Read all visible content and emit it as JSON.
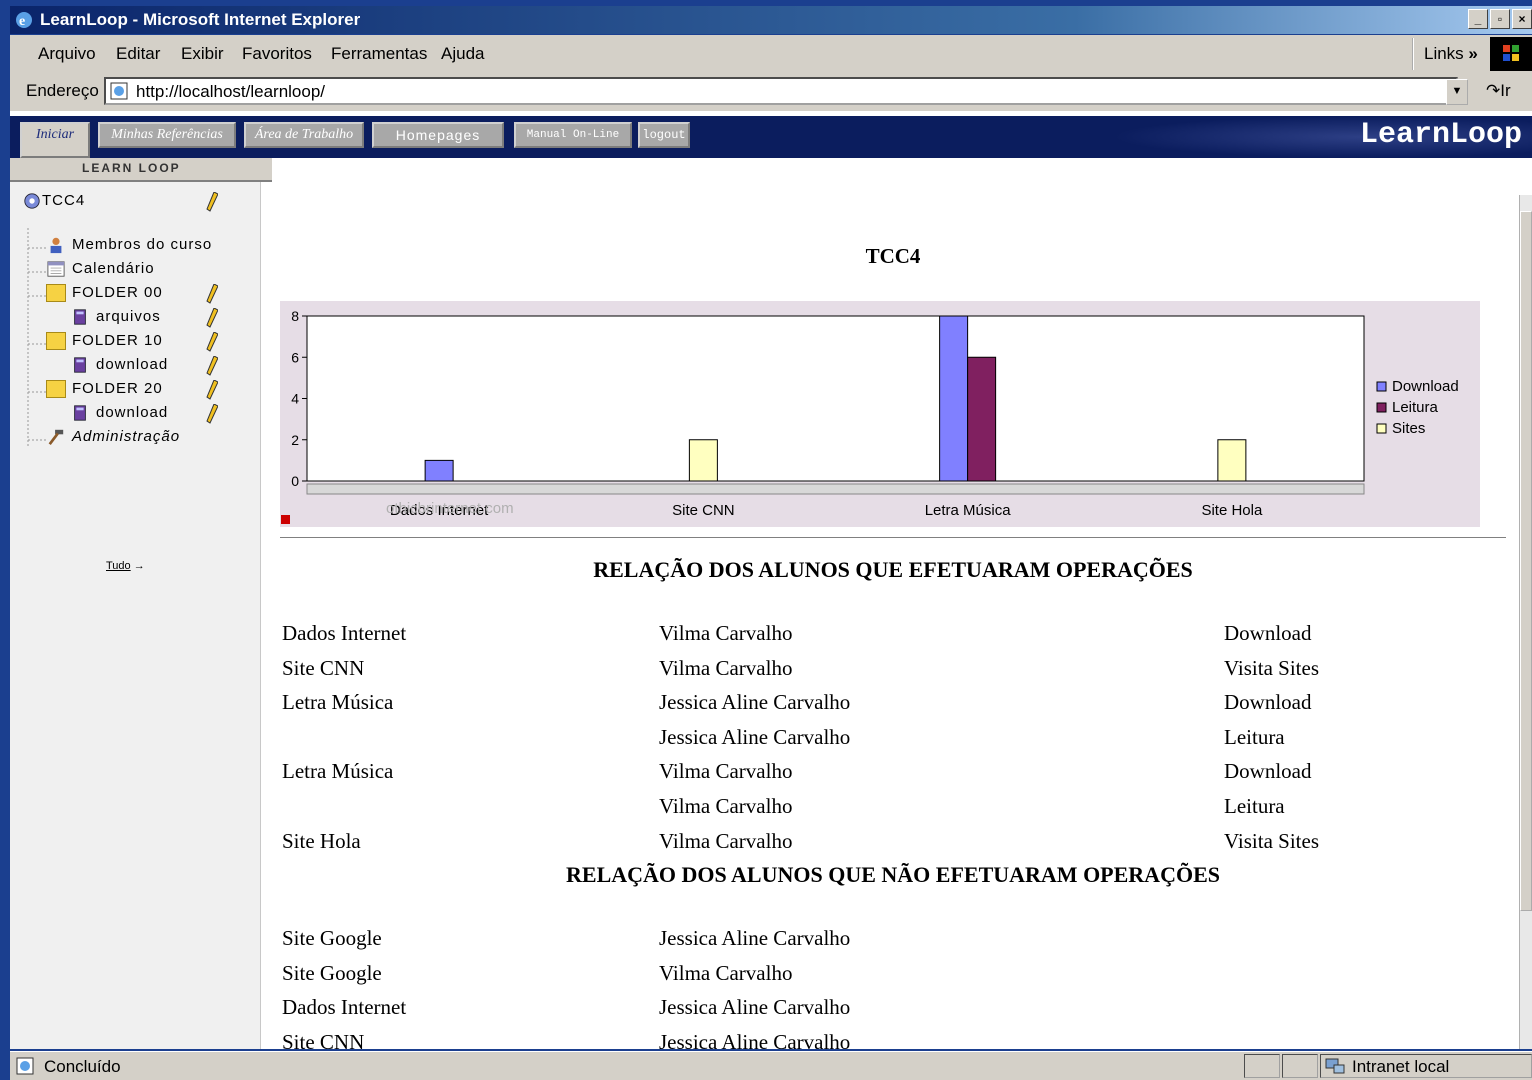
{
  "window": {
    "title": "LearnLoop - Microsoft Internet Explorer"
  },
  "menubar": {
    "items": [
      "Arquivo",
      "Editar",
      "Exibir",
      "Favoritos",
      "Ferramentas",
      "Ajuda"
    ],
    "links_label": "Links"
  },
  "addressbar": {
    "label": "Endereço",
    "url": "http://localhost/learnloop/",
    "go_label": "Ir"
  },
  "nav": {
    "tabs": [
      "Iniciar",
      "Minhas Referências",
      "Área de Trabalho",
      "Homepages",
      "Manual On-Line",
      "logout"
    ],
    "brand": "LearnLoop"
  },
  "sidebar": {
    "header": "LEARN LOOP",
    "root": "TCC4",
    "items": [
      "Membros do curso",
      "Calendário",
      "FOLDER 00",
      "arquivos",
      "FOLDER 10",
      "download",
      "FOLDER 20",
      "download",
      "Administração"
    ],
    "tudo_link": "Tudo"
  },
  "chart_data": {
    "type": "bar",
    "title": "TCC4",
    "categories": [
      "Dados Internet",
      "Site CNN",
      "Letra Música",
      "Site Hola"
    ],
    "series": [
      {
        "name": "Download",
        "values": [
          1,
          0,
          8,
          0
        ],
        "color": "#8080ff"
      },
      {
        "name": "Leitura",
        "values": [
          0,
          0,
          6,
          0
        ],
        "color": "#802060"
      },
      {
        "name": "Sites",
        "values": [
          0,
          2,
          0,
          2
        ],
        "color": "#ffffc0"
      }
    ],
    "ylim": [
      0,
      8
    ],
    "yticks": [
      "0",
      "2",
      "4",
      "6",
      "8"
    ],
    "legend": "right",
    "watermark": "othicbrinternet.com"
  },
  "operations": {
    "title": "RELAÇÃO DOS ALUNOS QUE EFETUARAM OPERAÇÕES",
    "rows": [
      [
        "Dados Internet",
        "Vilma Carvalho",
        "Download"
      ],
      [
        "Site CNN",
        "Vilma Carvalho",
        "Visita Sites"
      ],
      [
        "Letra Música",
        "Jessica Aline Carvalho",
        "Download"
      ],
      [
        "",
        "Jessica Aline Carvalho",
        "Leitura"
      ],
      [
        "Letra Música",
        "Vilma Carvalho",
        "Download"
      ],
      [
        "",
        "Vilma Carvalho",
        "Leitura"
      ],
      [
        "Site Hola",
        "Vilma Carvalho",
        "Visita Sites"
      ]
    ]
  },
  "no_operations": {
    "title": "RELAÇÃO DOS ALUNOS QUE NÃO EFETUARAM OPERAÇÕES",
    "rows": [
      [
        "Site Google",
        "Jessica Aline Carvalho"
      ],
      [
        "Site Google",
        "Vilma Carvalho"
      ],
      [
        "Dados Internet",
        "Jessica Aline Carvalho"
      ],
      [
        "Site CNN",
        "Jessica Aline Carvalho"
      ]
    ]
  },
  "statusbar": {
    "status": "Concluído",
    "zone": "Intranet local"
  }
}
